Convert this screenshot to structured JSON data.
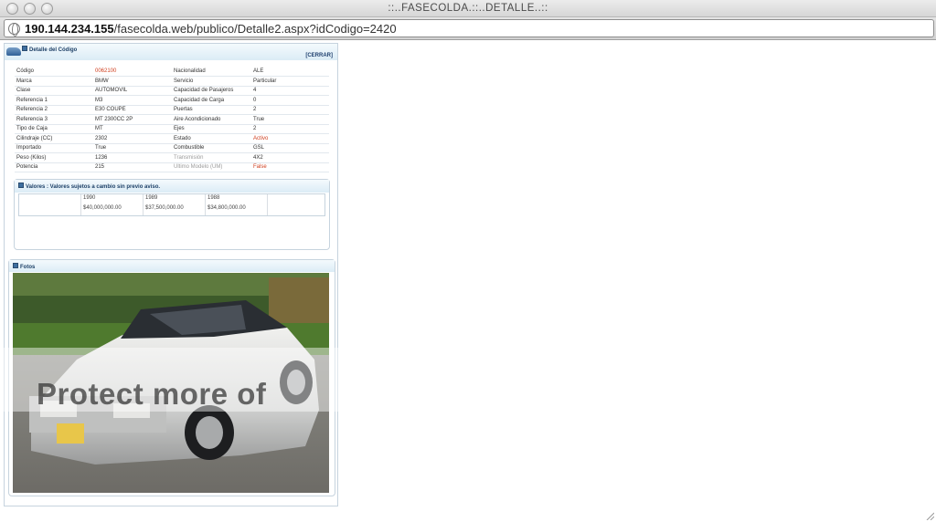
{
  "window": {
    "title": "::..FASECOLDA.::..DETALLE..::"
  },
  "address_bar": {
    "host": "190.144.234.155",
    "path": "/fasecolda.web/publico/Detalle2.aspx?idCodigo=2420"
  },
  "detail": {
    "title": "Detalle del Código",
    "close_label": "[CERRAR]",
    "rows": [
      {
        "l1": "Código",
        "v1": "0062100",
        "l2": "Nacionalidad",
        "v2": "ALE"
      },
      {
        "l1": "Marca",
        "v1": "BMW",
        "l2": "Servicio",
        "v2": "Particular"
      },
      {
        "l1": "Clase",
        "v1": "AUTOMOVIL",
        "l2": "Capacidad de Pasajeros",
        "v2": "4"
      },
      {
        "l1": "Referencia 1",
        "v1": "M3",
        "l2": "Capacidad de Carga",
        "v2": "0"
      },
      {
        "l1": "Referencia 2",
        "v1": "E30 COUPE",
        "l2": "Puertas",
        "v2": "2"
      },
      {
        "l1": "Referencia 3",
        "v1": "MT 2300CC 2P",
        "l2": "Aire Acondicionado",
        "v2": "True"
      },
      {
        "l1": "Tipo de Caja",
        "v1": "MT",
        "l2": "Ejes",
        "v2": "2"
      },
      {
        "l1": "Cilindraje (CC)",
        "v1": "2302",
        "l2": "Estado",
        "v2": "Activo"
      },
      {
        "l1": "Importado",
        "v1": "True",
        "l2": "Combustible",
        "v2": "GSL"
      },
      {
        "l1": "Peso (Kilos)",
        "v1": "1236",
        "l2": "Transmisión",
        "v2": "4X2"
      },
      {
        "l1": "Potencia",
        "v1": "215",
        "l2": "Ultimo Modelo (UM)",
        "v2": "False"
      }
    ]
  },
  "values_section": {
    "title": "Valores : Valores sujetos a cambio sin previo aviso.",
    "items": [
      {
        "year": "1990",
        "price": "$40,000,000.00"
      },
      {
        "year": "1989",
        "price": "$37,500,000.00"
      },
      {
        "year": "1988",
        "price": "$34,800,000.00"
      }
    ]
  },
  "photos_section": {
    "title": "Fotos"
  },
  "watermark": {
    "text": "Protect more of"
  },
  "colors": {
    "header_bg": "#dbecf6",
    "accent_text": "#1c3f66",
    "status_red": "#d04020"
  }
}
